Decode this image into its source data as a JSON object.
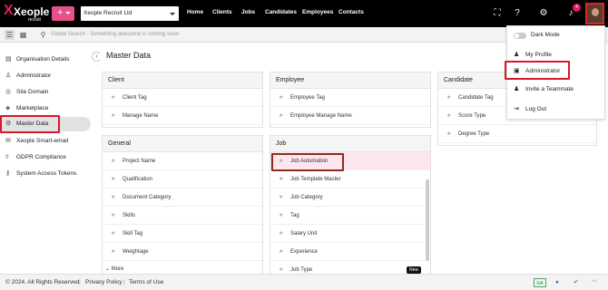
{
  "header": {
    "logo_text": "Xeople",
    "logo_sub": "recruit",
    "plus_label": "+",
    "company": "Xeople Recruit Ltd",
    "nav": [
      "Home",
      "Clients",
      "Jobs",
      "Candidates",
      "Employees",
      "Contacts"
    ],
    "notification_count": "4"
  },
  "search": {
    "placeholder": "Global Search - Something awesome is coming soon"
  },
  "sidebar": {
    "items": [
      {
        "label": "Organisation Details",
        "icon": "document-icon"
      },
      {
        "label": "Administrator",
        "icon": "user-icon"
      },
      {
        "label": "Site Domain",
        "icon": "globe-icon"
      },
      {
        "label": "Marketplace",
        "icon": "tag-icon"
      },
      {
        "label": "Master Data",
        "icon": "gear-icon"
      },
      {
        "label": "Xeople Smart-email",
        "icon": "mail-icon"
      },
      {
        "label": "GDPR Compliance",
        "icon": "shield-icon"
      },
      {
        "label": "System Access Tokens",
        "icon": "key-icon"
      }
    ]
  },
  "page": {
    "title": "Master Data"
  },
  "cards": {
    "client": {
      "title": "Client",
      "items": [
        "Client Tag",
        "Manage Name"
      ]
    },
    "employee": {
      "title": "Employee",
      "items": [
        "Employee Tag",
        "Employee Manage Name"
      ]
    },
    "candidate": {
      "title": "Candidate",
      "items": [
        "Candidate Tag",
        "Score Type",
        "Degree Type"
      ]
    },
    "general": {
      "title": "General",
      "items": [
        "Project Name",
        "Qualification",
        "Document Category",
        "Skills",
        "Skill Tag",
        "Weightage"
      ],
      "more": "More"
    },
    "job": {
      "title": "Job",
      "items": [
        "Job Automation",
        "Job Template Master",
        "Job Category",
        "Tag",
        "Salary Unit",
        "Experience",
        "Job Type"
      ],
      "new_badge": "New"
    }
  },
  "dropdown": {
    "items": [
      "Dark Mode",
      "My Profile",
      "Administrator",
      "Invite a Teammate",
      "Log Out"
    ]
  },
  "footer": {
    "copyright": "© 2024. All Rights Reserved",
    "privacy": "Privacy Policy",
    "terms": "Terms of Use",
    "ga_badge": "GA"
  },
  "colors": {
    "brand": "#e31b63",
    "highlight": "#d6182b",
    "job_automation_box": "#8b2d1f"
  }
}
